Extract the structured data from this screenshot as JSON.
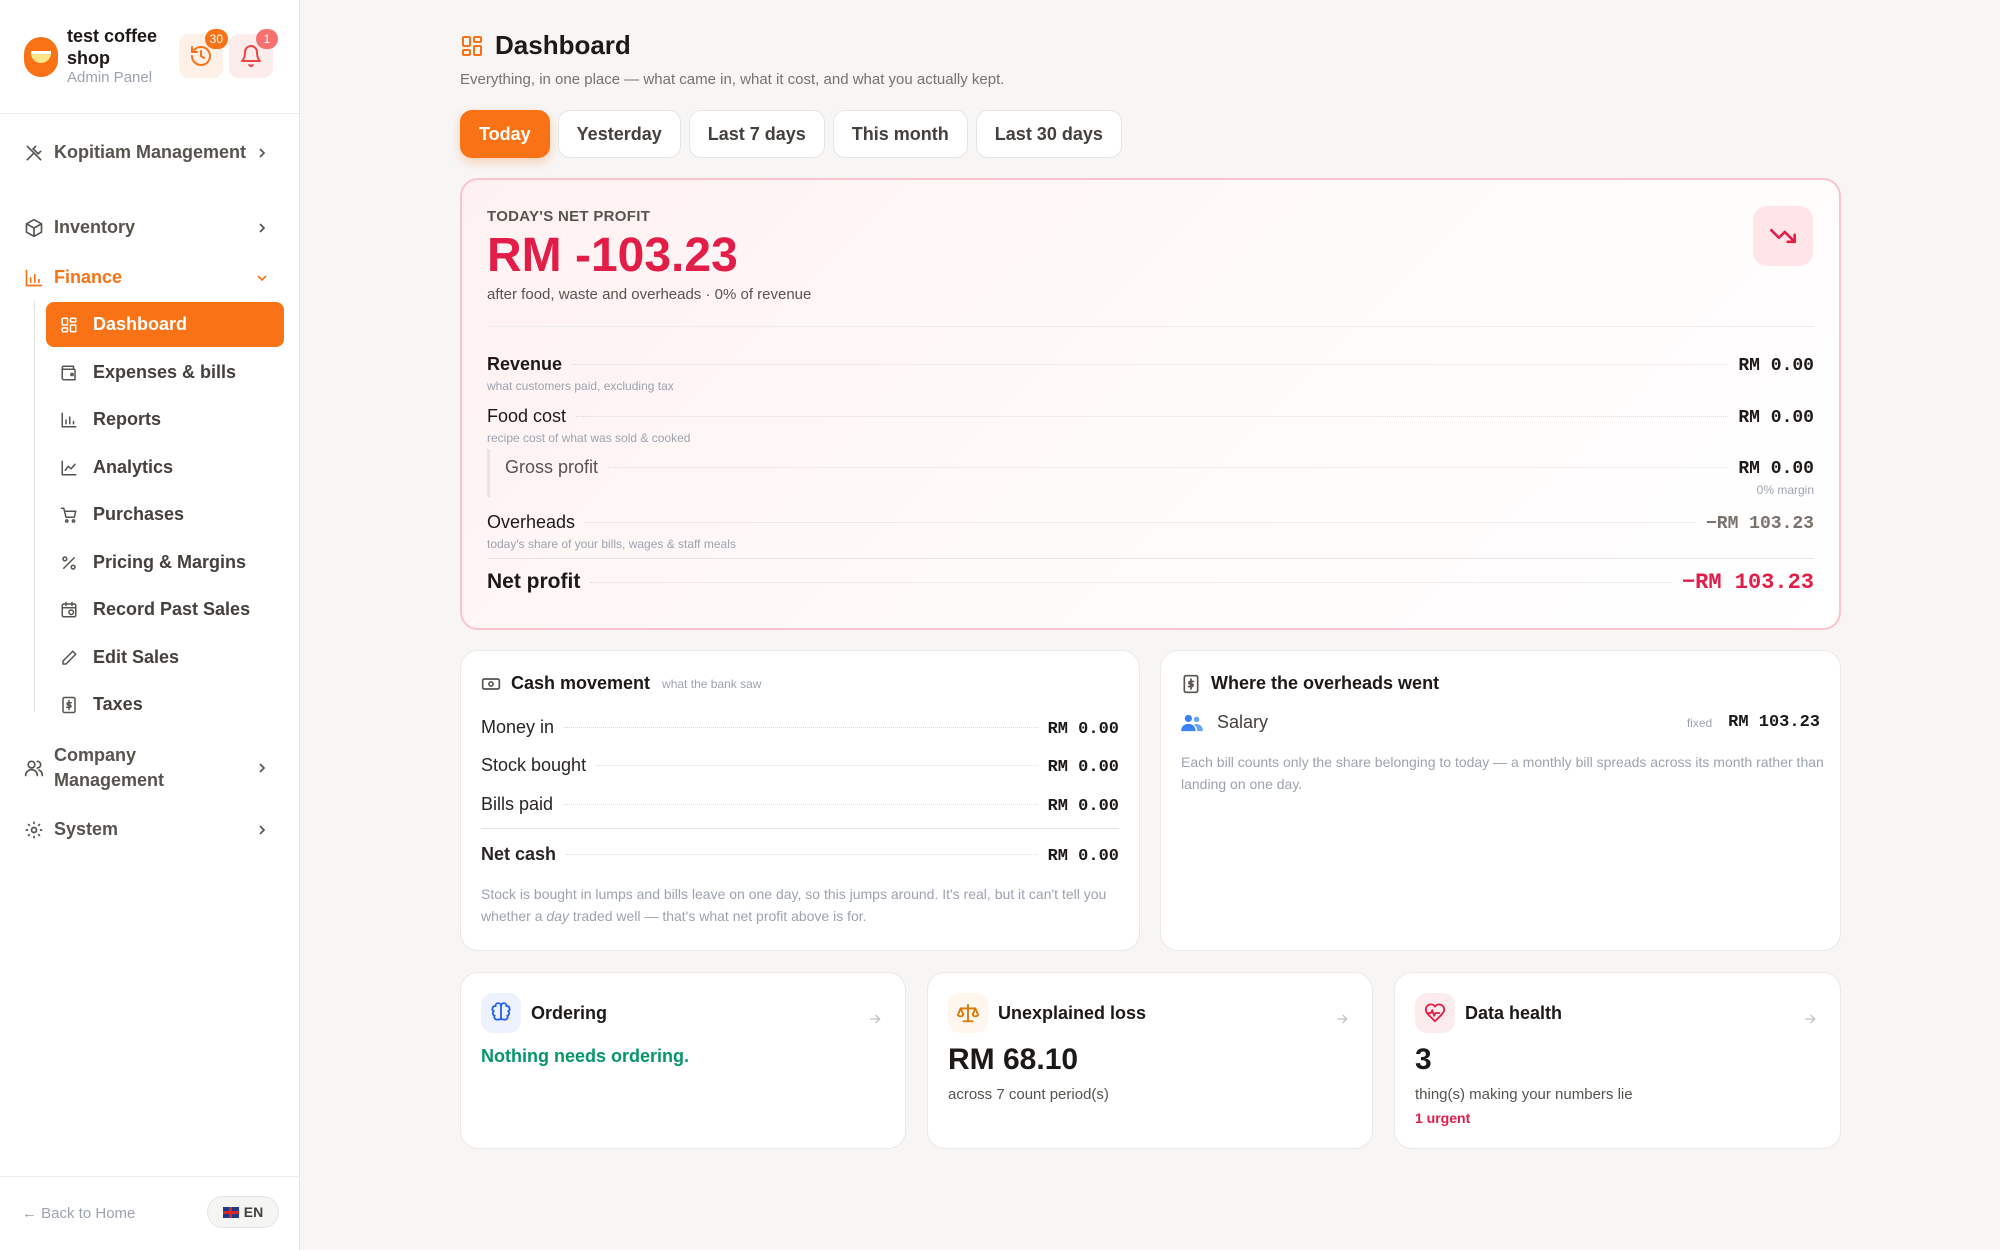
{
  "sidebar": {
    "brand_name": "test coffee shop",
    "brand_sub": "Admin Panel",
    "history_badge": "30",
    "notif_badge": "1",
    "nav": [
      {
        "label": "Kopitiam Management",
        "icon": "fork-knife-icon"
      },
      {
        "label": "Inventory",
        "icon": "box-icon"
      },
      {
        "label": "Finance",
        "icon": "bar-chart-icon"
      },
      {
        "label": "Company Management",
        "icon": "users-icon"
      },
      {
        "label": "System",
        "icon": "gear-icon"
      }
    ],
    "finance_items": [
      {
        "label": "Dashboard",
        "icon": "grid-icon"
      },
      {
        "label": "Expenses & bills",
        "icon": "wallet-icon"
      },
      {
        "label": "Reports",
        "icon": "bar-chart-icon"
      },
      {
        "label": "Analytics",
        "icon": "line-chart-icon"
      },
      {
        "label": "Purchases",
        "icon": "cart-icon"
      },
      {
        "label": "Pricing & Margins",
        "icon": "percent-icon"
      },
      {
        "label": "Record Past Sales",
        "icon": "calendar-clock-icon"
      },
      {
        "label": "Edit Sales",
        "icon": "pencil-icon"
      },
      {
        "label": "Taxes",
        "icon": "dollar-doc-icon"
      }
    ],
    "back_home": "← Back to Home",
    "language": "EN"
  },
  "header": {
    "title": "Dashboard",
    "subtitle": "Everything, in one place — what came in, what it cost, and what you actually kept."
  },
  "tabs": [
    "Today",
    "Yesterday",
    "Last 7 days",
    "This month",
    "Last 30 days"
  ],
  "active_tab": "Today",
  "profit": {
    "label": "TODAY'S NET PROFIT",
    "value": "RM -103.23",
    "note": "after food, waste and overheads · 0% of revenue",
    "revenue_label": "Revenue",
    "revenue_hint": "what customers paid, excluding tax",
    "revenue_value": "RM 0.00",
    "food_label": "Food cost",
    "food_hint": "recipe cost of what was sold & cooked",
    "food_value": "RM 0.00",
    "gross_label": "Gross profit",
    "gross_value": "RM 0.00",
    "gross_margin": "0% margin",
    "overheads_label": "Overheads",
    "overheads_hint": "today's share of your bills, wages & staff meals",
    "overheads_value": "−RM 103.23",
    "net_label": "Net profit",
    "net_value": "−RM 103.23"
  },
  "cash": {
    "title": "Cash movement",
    "subtitle": "what the bank saw",
    "money_in_label": "Money in",
    "money_in_value": "RM 0.00",
    "stock_label": "Stock bought",
    "stock_value": "RM 0.00",
    "bills_label": "Bills paid",
    "bills_value": "RM 0.00",
    "net_label": "Net cash",
    "net_value": "RM 0.00",
    "note_a": "Stock is bought in lumps and bills leave on one day, so this jumps around. It's real, but it can't tell you whether a ",
    "note_em": "day",
    "note_b": " traded well — that's what net profit above is for."
  },
  "overheads": {
    "title": "Where the overheads went",
    "item_label": "Salary",
    "item_tag": "fixed",
    "item_value": "RM 103.23",
    "note": "Each bill counts only the share belonging to today — a monthly bill spreads across its month rather than landing on one day."
  },
  "ordering": {
    "title": "Ordering",
    "status": "Nothing needs ordering."
  },
  "loss": {
    "title": "Unexplained loss",
    "value": "RM 68.10",
    "note": "across 7 count period(s)"
  },
  "health": {
    "title": "Data health",
    "value": "3",
    "note": "thing(s) making your numbers lie",
    "urgent": "1 urgent"
  },
  "colors": {
    "accent": "#f97316",
    "negative": "#e11d48",
    "positive": "#059669"
  }
}
